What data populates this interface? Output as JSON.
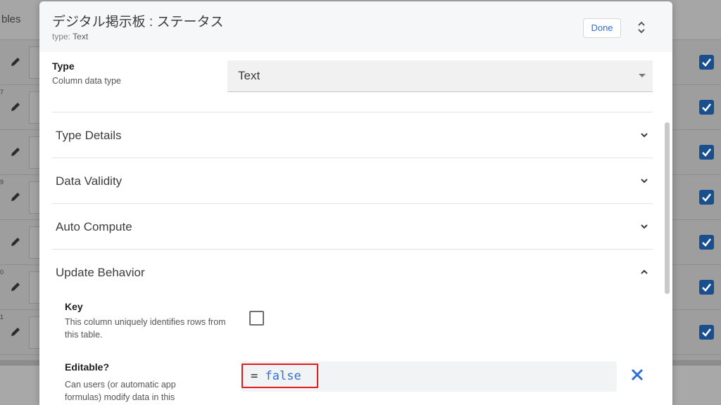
{
  "background": {
    "header_text": "bles",
    "row_numbers": [
      "",
      "7",
      "",
      "9",
      "",
      "0",
      "1"
    ]
  },
  "dialog": {
    "title": "デジタル掲示板 : ステータス",
    "subtitle_prefix": "type:",
    "subtitle_value": "Text",
    "done_label": "Done",
    "type_field": {
      "label": "Type",
      "description": "Column data type",
      "value": "Text"
    },
    "sections": [
      {
        "label": "Type Details",
        "expanded": false
      },
      {
        "label": "Data Validity",
        "expanded": false
      },
      {
        "label": "Auto Compute",
        "expanded": false
      },
      {
        "label": "Update Behavior",
        "expanded": true
      }
    ],
    "key_field": {
      "label": "Key",
      "description": "This column uniquely identifies rows from this table.",
      "checked": false
    },
    "editable_field": {
      "label": "Editable?",
      "description": "Can users (or automatic app formulas) modify data in this",
      "formula_eq": "=",
      "formula_value": "false"
    }
  },
  "colors": {
    "accent": "#2d6fd4",
    "highlight_border": "#e01d1d",
    "checkbox_bg": "#1a4f8e"
  }
}
